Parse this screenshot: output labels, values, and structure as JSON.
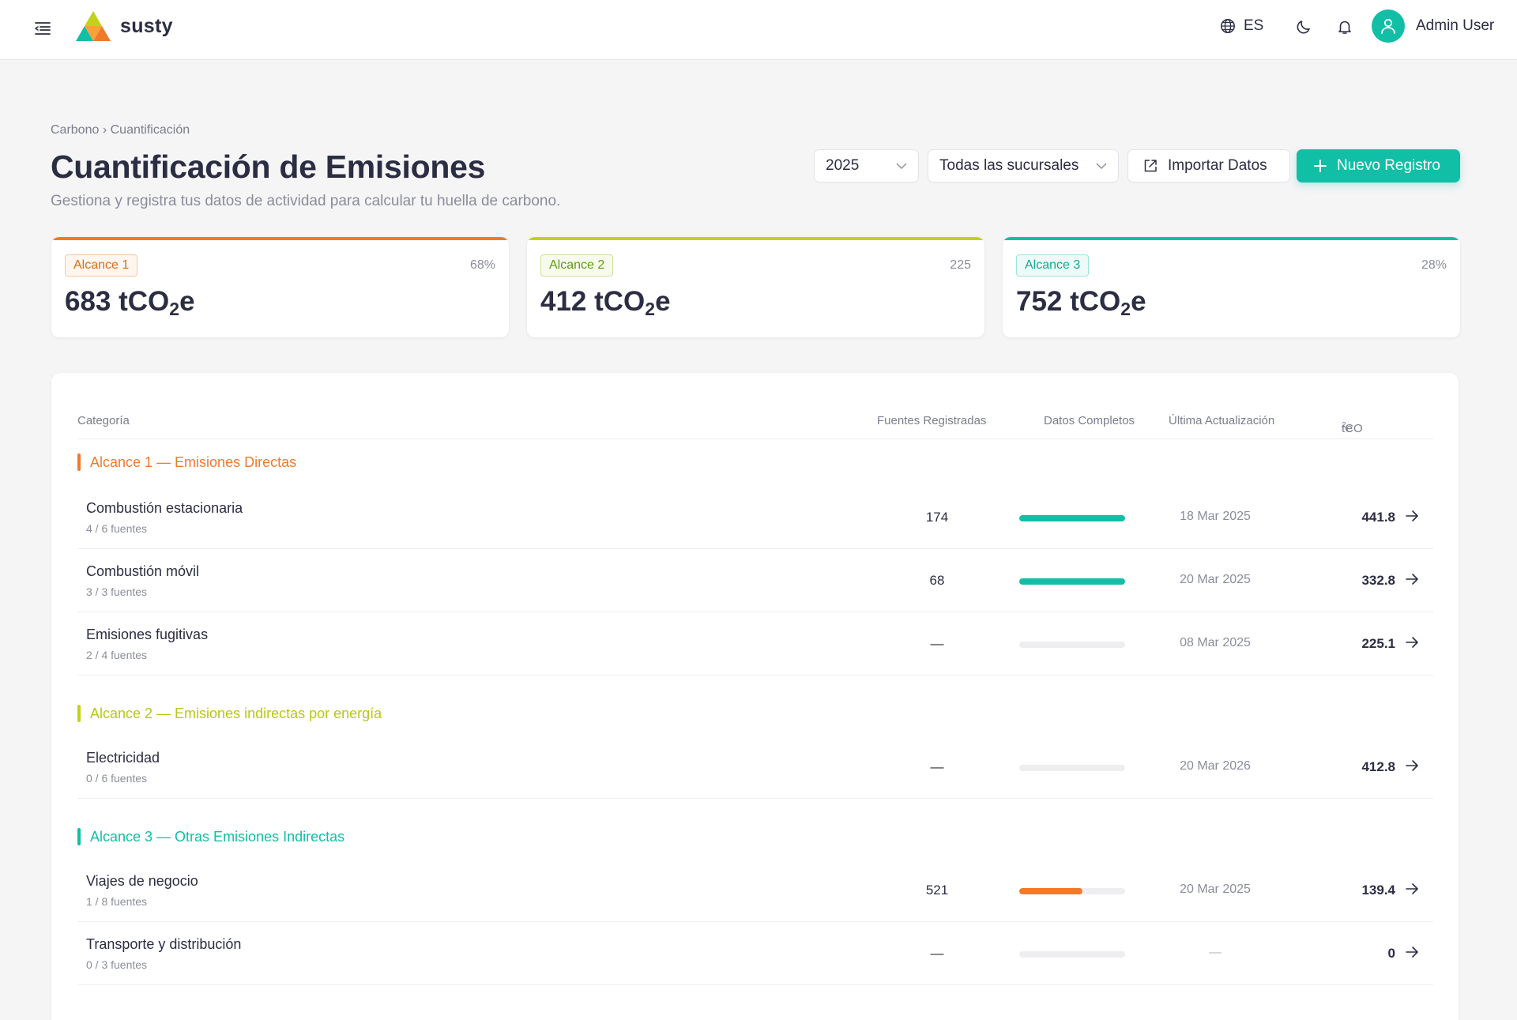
{
  "brand": {
    "name": "susty"
  },
  "topbar": {
    "language": "ES",
    "user_name": "Admin User"
  },
  "breadcrumb": {
    "parent": "Carbono",
    "separator": "›",
    "current": "Cuantificación"
  },
  "page": {
    "title": "Cuantificación de Emisiones",
    "subtitle": "Gestiona y registra tus datos de actividad para calcular tu huella de carbono."
  },
  "controls": {
    "year": "2025",
    "branch": "Todas las sucursales",
    "import_label": "Importar Datos",
    "new_label": "Nuevo Registro"
  },
  "cards": [
    {
      "badge": "Alcance 1",
      "right": "68%",
      "value_prefix": "683 tCO",
      "value_sub": "2",
      "value_suffix": "e",
      "color": "#f07a2a"
    },
    {
      "badge": "Alcance 2",
      "right": "225",
      "value_prefix": "412 tCO",
      "value_sub": "2",
      "value_suffix": "e",
      "color": "#c3d11a"
    },
    {
      "badge": "Alcance 3",
      "right": "28%",
      "value_prefix": "752 tCO",
      "value_sub": "2",
      "value_suffix": "e",
      "color": "#10bfa5"
    }
  ],
  "table": {
    "headers": {
      "category": "Categoría",
      "sources": "Fuentes Registradas",
      "complete": "Datos Completos",
      "updated": "Última Actualización",
      "tco_prefix": "tCO",
      "tco_sub": "2",
      "tco_suffix": "e"
    },
    "sections": [
      {
        "title": "Alcance 1 — Emisiones Directas",
        "color": "#f07a2a"
      },
      {
        "title": "Alcance 2 — Emisiones indirectas por energía",
        "color": "#c3d11a"
      },
      {
        "title": "Alcance 3 — Otras Emisiones Indirectas",
        "color": "#10bfa5"
      }
    ],
    "rows": [
      {
        "name": "Combustión estacionaria",
        "sub": "4 / 6 fuentes",
        "sources": "174",
        "complete": 1.0,
        "bar_color": "#10bfa5",
        "updated": "18 Mar 2025",
        "tco": "441.8"
      },
      {
        "name": "Combustión móvil",
        "sub": "3 / 3 fuentes",
        "sources": "68",
        "complete": 1.0,
        "bar_color": "#10bfa5",
        "updated": "20 Mar 2025",
        "tco": "332.8"
      },
      {
        "name": "Emisiones fugitivas",
        "sub": "2 / 4 fuentes",
        "sources": "—",
        "complete": 0,
        "bar_color": "#10bfa5",
        "updated": "08 Mar 2025",
        "tco": "225.1"
      },
      {
        "name": "Electricidad",
        "sub": "0 / 6 fuentes",
        "sources": "—",
        "complete": 0,
        "bar_color": "#10bfa5",
        "updated": "20 Mar 2026",
        "tco": "412.8"
      },
      {
        "name": "Viajes de negocio",
        "sub": "1 / 8 fuentes",
        "sources": "521",
        "complete": 0.6,
        "bar_color": "#f07a2a",
        "updated": "20 Mar 2025",
        "tco": "139.4"
      },
      {
        "name": "Transporte y distribución",
        "sub": "0 / 3 fuentes",
        "sources": "—",
        "complete": 0,
        "bar_color": "#10bfa5",
        "updated": "—",
        "tco": "0"
      }
    ]
  }
}
